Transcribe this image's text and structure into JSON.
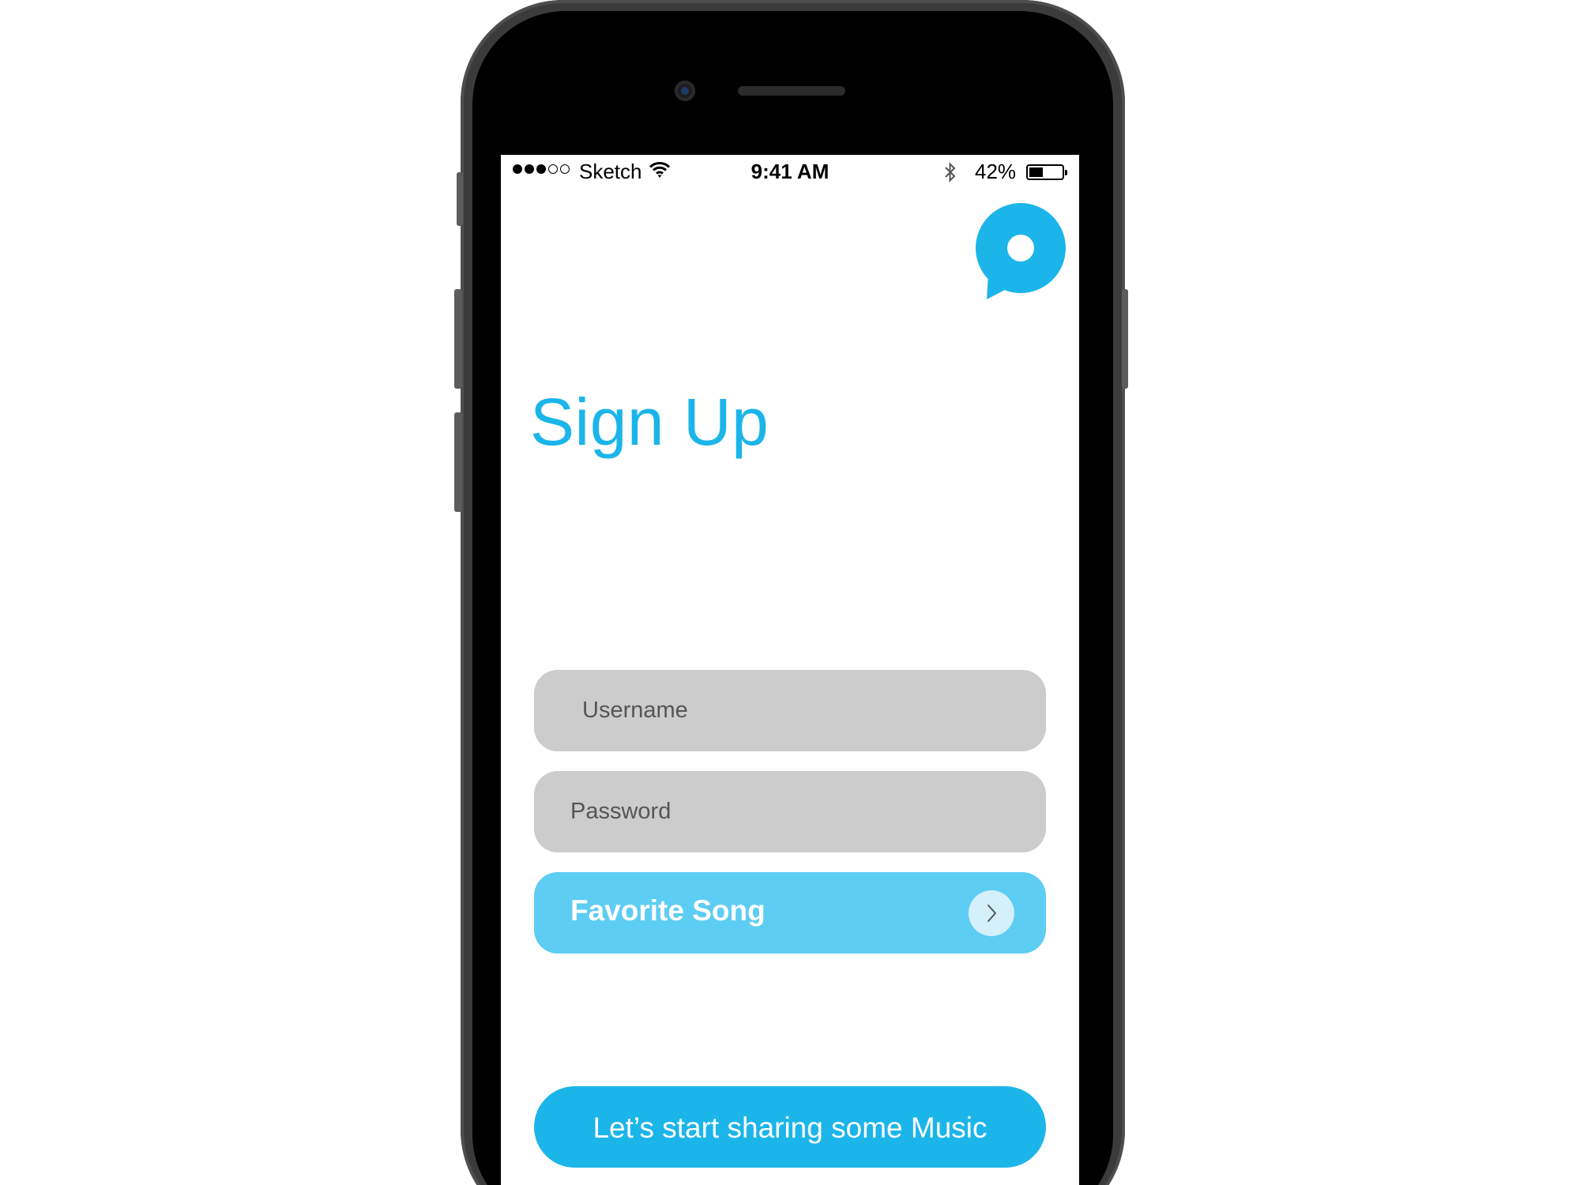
{
  "status_bar": {
    "signal_filled": 3,
    "signal_total": 5,
    "carrier": "Sketch",
    "time": "9:41 AM",
    "battery_percent_label": "42%",
    "battery_level": 0.42
  },
  "header": {
    "title": "Sign Up"
  },
  "form": {
    "username_placeholder": "Username",
    "password_placeholder": "Password",
    "favorite_song_label": "Favorite Song"
  },
  "cta": {
    "label": "Let’s start sharing some Music"
  },
  "colors": {
    "accent": "#1bb5ea",
    "accent_light": "#5dcdf3",
    "field_bg": "#cccccc",
    "phone_body": "#3b3b3b"
  },
  "icons": {
    "logo": "chat-bubble-logo-icon",
    "wifi": "wifi-icon",
    "bluetooth": "bluetooth-icon",
    "battery": "battery-icon",
    "arrow": "chevron-right-icon"
  }
}
